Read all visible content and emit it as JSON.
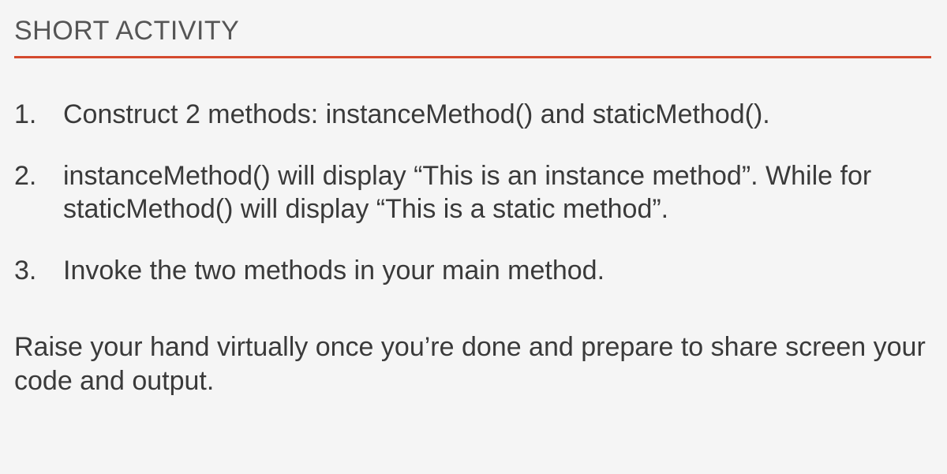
{
  "slide": {
    "title": "SHORT ACTIVITY",
    "items": [
      "Construct 2 methods: instanceMethod() and staticMethod().",
      "instanceMethod() will display “This is an instance method”. While for staticMethod() will display “This is a static method”.",
      "Invoke the two methods in your main method."
    ],
    "footer": "Raise your hand virtually once you’re done and prepare to share screen your code and output."
  }
}
